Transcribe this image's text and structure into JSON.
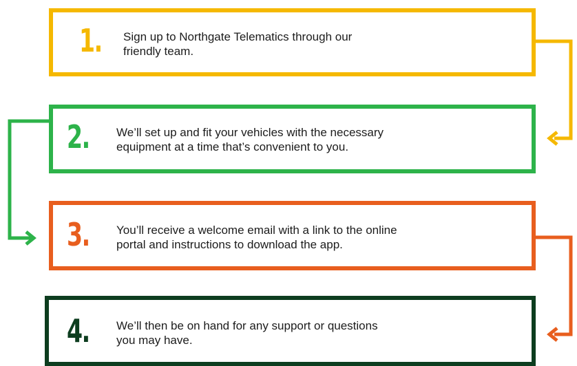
{
  "colors": {
    "step1": "#f5b800",
    "step2": "#2db34a",
    "step3": "#e85e1e",
    "step4": "#0d3d1f"
  },
  "steps": [
    {
      "number": "1.",
      "lines": [
        "Sign up to Northgate Telematics through our",
        "friendly team."
      ]
    },
    {
      "number": "2.",
      "lines": [
        "We’ll set up and fit your vehicles with the necessary",
        "equipment at a time that’s convenient to you."
      ]
    },
    {
      "number": "3.",
      "lines": [
        "You’ll receive a welcome email with a link to the online",
        "portal and instructions to download the app."
      ]
    },
    {
      "number": "4.",
      "lines": [
        "We’ll then be on hand for any support or questions",
        "you may have."
      ]
    }
  ]
}
